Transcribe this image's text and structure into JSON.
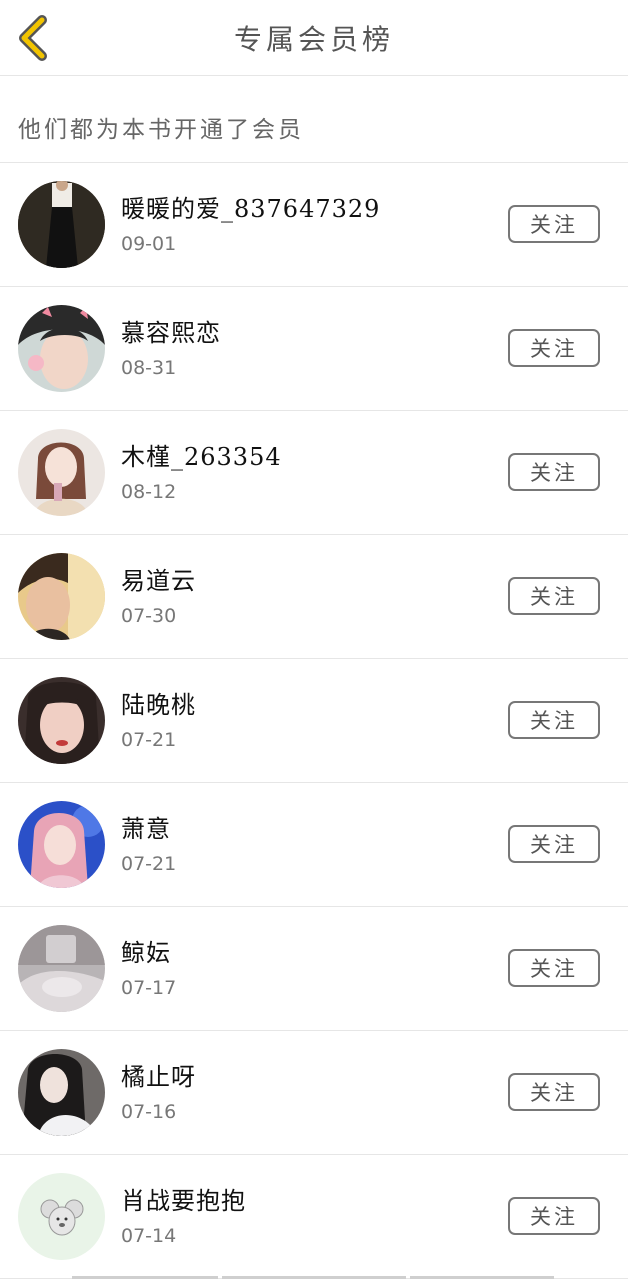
{
  "header": {
    "title": "专属会员榜"
  },
  "subtitle": "他们都为本书开通了会员",
  "members": [
    {
      "name": "暖暖的爱_837647329",
      "date": "09-01",
      "follow": "关注"
    },
    {
      "name": "慕容熙恋",
      "date": "08-31",
      "follow": "关注"
    },
    {
      "name": "木槿_263354",
      "date": "08-12",
      "follow": "关注"
    },
    {
      "name": "易道云",
      "date": "07-30",
      "follow": "关注"
    },
    {
      "name": "陆晚桃",
      "date": "07-21",
      "follow": "关注"
    },
    {
      "name": "萧意",
      "date": "07-21",
      "follow": "关注"
    },
    {
      "name": "鲸妘",
      "date": "07-17",
      "follow": "关注"
    },
    {
      "name": "橘止呀",
      "date": "07-16",
      "follow": "关注"
    },
    {
      "name": "肖战要抱抱",
      "date": "07-14",
      "follow": "关注"
    }
  ],
  "colors": {
    "back_arrow": "#f2c400",
    "back_arrow_outline": "#555555"
  }
}
